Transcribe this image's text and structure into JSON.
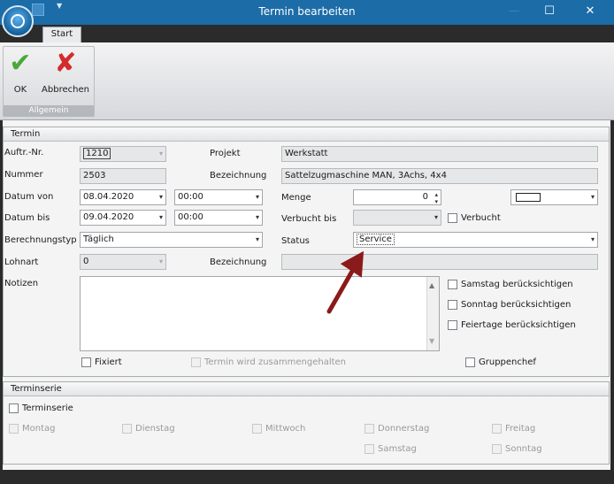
{
  "window": {
    "title": "Termin bearbeiten",
    "min_glyph": "—",
    "max_glyph": "☐",
    "close_glyph": "✕"
  },
  "ribbon": {
    "tab_start": "Start",
    "group_label": "Allgemein",
    "ok_label": "OK",
    "cancel_label": "Abbrechen",
    "ok_icon": "checkmark-icon",
    "cancel_icon": "x-icon",
    "colors": {
      "ok": "#4aa83a",
      "cancel": "#d42b2b",
      "accent": "#1c6ca8"
    }
  },
  "termin": {
    "header": "Termin",
    "auftr_label": "Auftr.-Nr.",
    "auftr_value": "1210",
    "projekt_label": "Projekt",
    "projekt_value": "Werkstatt",
    "nummer_label": "Nummer",
    "nummer_value": "2503",
    "bezeichnung_label": "Bezeichnung",
    "bezeichnung_value": "Sattelzugmaschine MAN, 3Achs, 4x4",
    "datum_von_label": "Datum von",
    "datum_von_value": "08.04.2020",
    "zeit_von_value": "00:00",
    "menge_label": "Menge",
    "menge_value": "0",
    "datum_bis_label": "Datum bis",
    "datum_bis_value": "09.04.2020",
    "zeit_bis_value": "00:00",
    "verbucht_bis_label": "Verbucht bis",
    "verbucht_bis_value": "",
    "verbucht_label": "Verbucht",
    "berechnungstyp_label": "Berechnungstyp",
    "berechnungstyp_value": "Täglich",
    "status_label": "Status",
    "status_value": "Service",
    "lohnart_label": "Lohnart",
    "lohnart_value": "0",
    "bezeichnung2_label": "Bezeichnung",
    "bezeichnung2_value": "",
    "notizen_label": "Notizen",
    "notizen_value": "",
    "samstag_label": "Samstag berücksichtigen",
    "sonntag_label": "Sonntag berücksichtigen",
    "feiertage_label": "Feiertage berücksichtigen",
    "fixiert_label": "Fixiert",
    "zusammen_label": "Termin wird zusammengehalten",
    "gruppenchef_label": "Gruppenchef"
  },
  "serie": {
    "header": "Terminserie",
    "terminserie_label": "Terminserie",
    "montag": "Montag",
    "dienstag": "Dienstag",
    "mittwoch": "Mittwoch",
    "donnerstag": "Donnerstag",
    "freitag": "Freitag",
    "samstag": "Samstag",
    "sonntag": "Sonntag"
  },
  "annotation": {
    "arrow_color": "#8b1a1a"
  }
}
